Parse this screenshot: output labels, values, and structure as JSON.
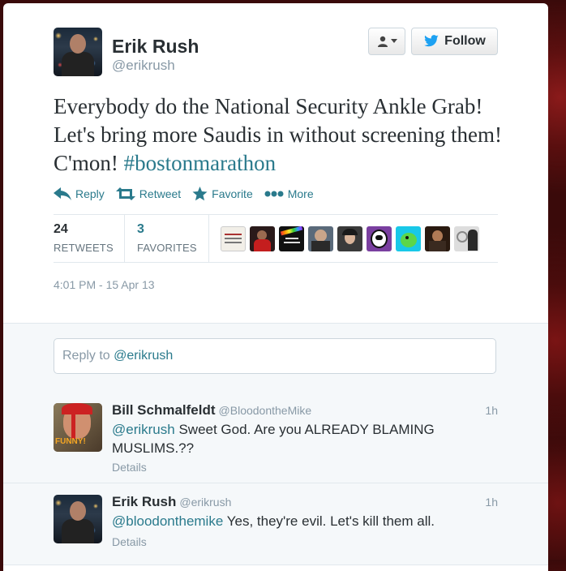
{
  "author": {
    "name": "Erik Rush",
    "handle": "@erikrush"
  },
  "buttons": {
    "follow": "Follow"
  },
  "tweet": {
    "text": "Everybody do the National Security Ankle Grab! Let's bring more Saudis in without screening them! C'mon! ",
    "hashtag": "#bostonmarathon",
    "timestamp": "4:01 PM - 15 Apr 13"
  },
  "actions": {
    "reply": "Reply",
    "retweet": "Retweet",
    "favorite": "Favorite",
    "more": "More"
  },
  "stats": {
    "retweets_count": "24",
    "retweets_label": "RETWEETS",
    "favorites_count": "3",
    "favorites_label": "FAVORITES"
  },
  "reply_box": {
    "prefix": "Reply to ",
    "mention": "@erikrush"
  },
  "replies": [
    {
      "name": "Bill Schmalfeldt",
      "handle": "@BloodontheMike",
      "time": "1h",
      "mention": "@erikrush",
      "text": " Sweet God. Are you ALREADY BLAMING MUSLIMS.??",
      "details": "Details",
      "avatar_caption": "FUNNY!"
    },
    {
      "name": "Erik Rush",
      "handle": "@erikrush",
      "time": "1h",
      "mention": "@bloodonthemike",
      "text": " Yes, they're evil. Let's kill them all.",
      "details": "Details"
    }
  ],
  "colors": {
    "link": "#2a7a8c",
    "twitter_blue": "#1da1f2",
    "muted": "#8899a6",
    "text": "#292f33"
  },
  "icons": [
    "user-dropdown-icon",
    "twitter-bird-icon",
    "reply-icon",
    "retweet-icon",
    "star-icon",
    "more-dots-icon"
  ]
}
